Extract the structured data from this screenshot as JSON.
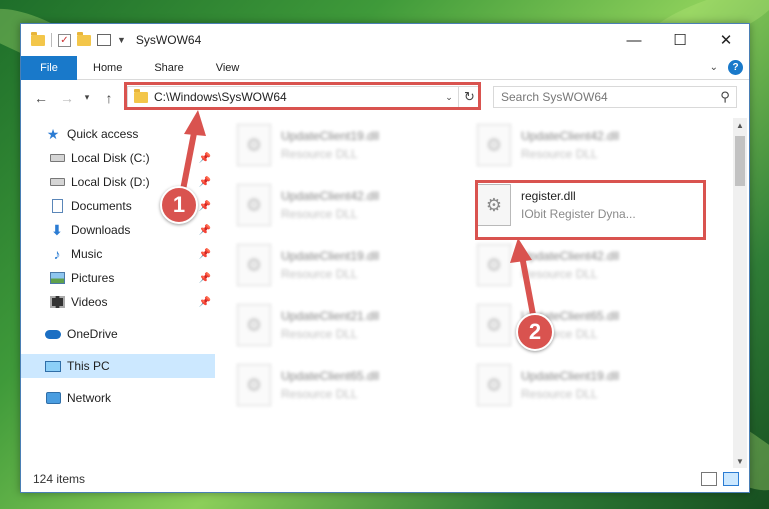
{
  "window": {
    "title": "SysWOW64",
    "controls": {
      "minimize": "—",
      "maximize": "☐",
      "close": "✕"
    }
  },
  "ribbon": {
    "tabs": [
      "File",
      "Home",
      "Share",
      "View"
    ],
    "help": "?"
  },
  "nav": {
    "address": "C:\\Windows\\SysWOW64",
    "search_placeholder": "Search SysWOW64"
  },
  "sidebar": {
    "items": [
      {
        "label": "Quick access",
        "icon": "star-icon"
      },
      {
        "label": "Local Disk (C:)",
        "icon": "disk-icon",
        "pinned": true
      },
      {
        "label": "Local Disk (D:)",
        "icon": "disk-icon",
        "pinned": true
      },
      {
        "label": "Documents",
        "icon": "documents-icon",
        "pinned": true
      },
      {
        "label": "Downloads",
        "icon": "downloads-icon",
        "pinned": true
      },
      {
        "label": "Music",
        "icon": "music-icon",
        "pinned": true
      },
      {
        "label": "Pictures",
        "icon": "pictures-icon",
        "pinned": true
      },
      {
        "label": "Videos",
        "icon": "videos-icon",
        "pinned": true
      },
      {
        "label": "OneDrive",
        "icon": "onedrive-icon"
      },
      {
        "label": "This PC",
        "icon": "this-pc-icon",
        "selected": true
      },
      {
        "label": "Network",
        "icon": "network-icon"
      }
    ]
  },
  "files": {
    "left": [
      {
        "name": "UpdateClient19.dll",
        "type": "Resource DLL"
      },
      {
        "name": "UpdateClient42.dll",
        "type": "Resource DLL"
      },
      {
        "name": "UpdateClient19.dll",
        "type": "Resource DLL"
      },
      {
        "name": "UpdateClient21.dll",
        "type": "Resource DLL"
      },
      {
        "name": "UpdateClient65.dll",
        "type": "Resource DLL"
      }
    ],
    "right": [
      {
        "name": "UpdateClient42.dll",
        "type": "Resource DLL"
      },
      {
        "name": "register.dll",
        "type": "IObit Register Dyna...",
        "highlighted": true
      },
      {
        "name": "UpdateClient42.dll",
        "type": "Resource DLL"
      },
      {
        "name": "UpdateClient65.dll",
        "type": "Resource DLL"
      },
      {
        "name": "UpdateClient19.dll",
        "type": "Resource DLL"
      }
    ]
  },
  "status": {
    "item_count": "124 items"
  },
  "annotations": {
    "step1": "1",
    "step2": "2",
    "color": "#d9534f"
  }
}
